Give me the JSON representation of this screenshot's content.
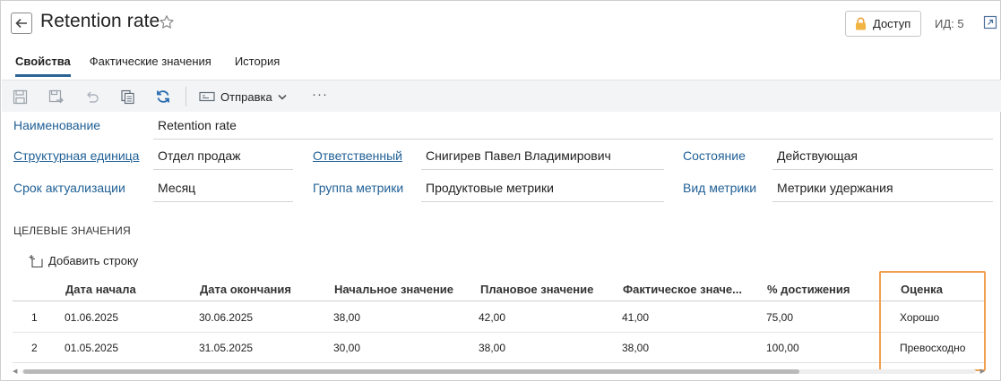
{
  "header": {
    "title": "Retention rate",
    "access_label": "Доступ",
    "id_label": "ИД: 5"
  },
  "tabs": [
    {
      "label": "Свойства",
      "active": true
    },
    {
      "label": "Фактические значения",
      "active": false
    },
    {
      "label": "История",
      "active": false
    }
  ],
  "toolbar": {
    "icons": [
      "save-icon",
      "save-as-icon",
      "undo-icon",
      "copy-icon",
      "refresh-icon"
    ],
    "send_label": "Отправка",
    "more_label": "···"
  },
  "form": {
    "name": {
      "label": "Наименование",
      "value": "Retention rate"
    },
    "unit": {
      "label": "Структурная единица",
      "value": "Отдел продаж"
    },
    "responsible": {
      "label": "Ответственный",
      "value": "Снигирев Павел Владимирович"
    },
    "state": {
      "label": "Состояние",
      "value": "Действующая"
    },
    "period": {
      "label": "Срок актуализации",
      "value": "Месяц"
    },
    "group": {
      "label": "Группа метрики",
      "value": "Продуктовые метрики"
    },
    "kind": {
      "label": "Вид метрики",
      "value": "Метрики удержания"
    }
  },
  "targets": {
    "section_title": "ЦЕЛЕВЫЕ ЗНАЧЕНИЯ",
    "add_row_label": "Добавить строку",
    "columns": [
      "Дата начала",
      "Дата окончания",
      "Начальное значение",
      "Плановое значение",
      "Фактическое значе...",
      "% достижения",
      "Оценка"
    ],
    "rows": [
      {
        "num": "1",
        "start": "01.06.2025",
        "end": "30.06.2025",
        "initial": "38,00",
        "plan": "42,00",
        "fact": "41,00",
        "percent": "75,00",
        "rating": "Хорошо"
      },
      {
        "num": "2",
        "start": "01.05.2025",
        "end": "31.05.2025",
        "initial": "30,00",
        "plan": "38,00",
        "fact": "38,00",
        "percent": "100,00",
        "rating": "Превосходно"
      }
    ]
  },
  "colors": {
    "accent": "#2a6496",
    "link": "#1f5f95",
    "highlight": "#f0a050"
  }
}
